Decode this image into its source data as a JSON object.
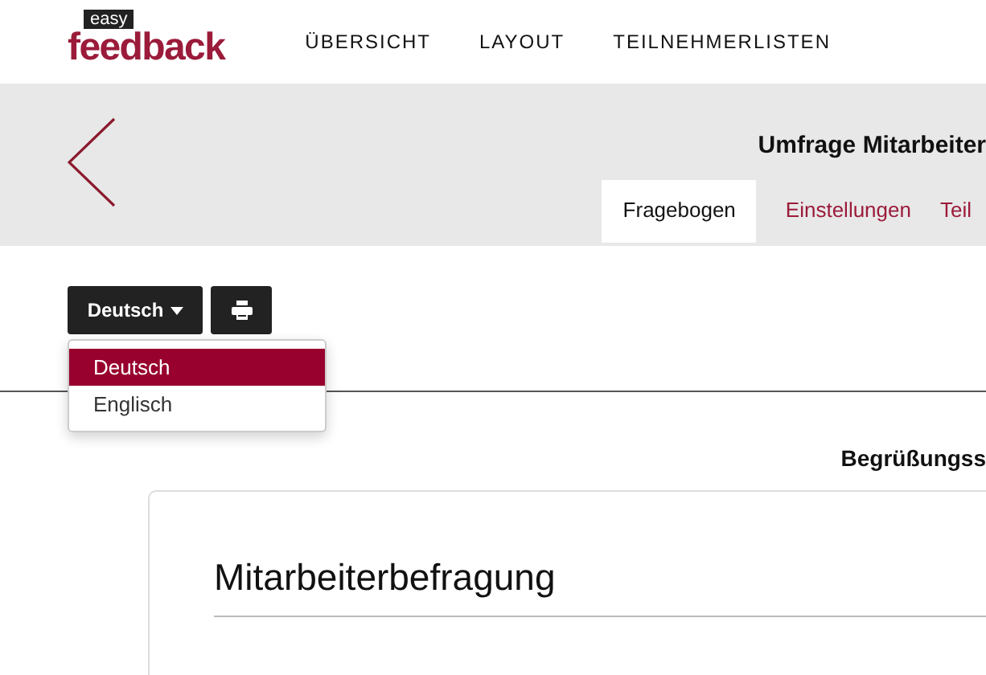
{
  "logo": {
    "small": "easy",
    "main": "feedback"
  },
  "nav": [
    {
      "label": "ÜBERSICHT"
    },
    {
      "label": "LAYOUT"
    },
    {
      "label": "TEILNEHMERLISTEN"
    }
  ],
  "survey": {
    "title": "Umfrage Mitarbeiter"
  },
  "tabs": [
    {
      "label": "Fragebogen",
      "selected": true
    },
    {
      "label": "Einstellungen",
      "selected": false
    },
    {
      "label": "Teil",
      "selected": false
    }
  ],
  "language_button": {
    "label": "Deutsch"
  },
  "language_menu": [
    {
      "label": "Deutsch",
      "selected": true
    },
    {
      "label": "Englisch",
      "selected": false
    }
  ],
  "page_heading": "Begrüßungss",
  "card": {
    "heading": "Mitarbeiterbefragung"
  }
}
